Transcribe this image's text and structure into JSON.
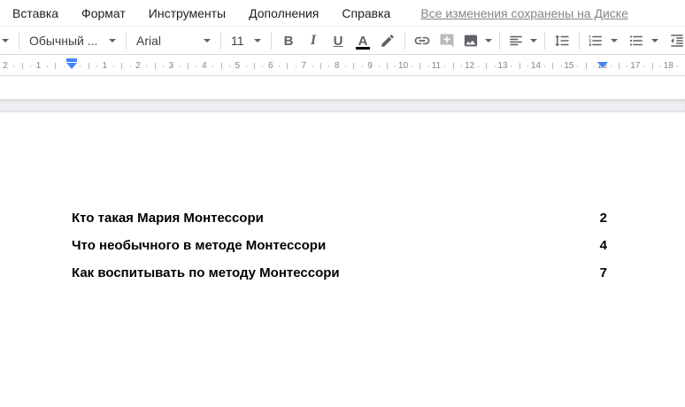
{
  "menu": {
    "items": [
      "Вставка",
      "Формат",
      "Инструменты",
      "Дополнения",
      "Справка"
    ],
    "saved_status": "Все изменения сохранены на Диске"
  },
  "toolbar": {
    "style_dropdown": "Обычный ...",
    "font_dropdown": "Arial",
    "font_size": "11",
    "bold_label": "B",
    "italic_label": "I",
    "underline_label": "U",
    "text_color_label": "A",
    "icons": [
      "highlight-pen",
      "insert-link",
      "add-comment",
      "insert-image",
      "align-left",
      "line-spacing",
      "numbered-list",
      "bulleted-list",
      "indent-decrease"
    ]
  },
  "ruler": {
    "left_labels": [
      "2",
      "1"
    ],
    "right_labels": [
      "1",
      "2",
      "3",
      "4",
      "5",
      "6",
      "7",
      "8",
      "9",
      "10",
      "11",
      "12",
      "13",
      "14",
      "15",
      "16",
      "17",
      "18"
    ]
  },
  "document": {
    "toc": [
      {
        "title": "Кто такая Мария Монтессори",
        "page": "2"
      },
      {
        "title": "Что необычного в методе Монтессори",
        "page": "4"
      },
      {
        "title": "Как воспитывать по методу Монтессори",
        "page": "7"
      }
    ]
  },
  "colors": {
    "accent_blue": "#4285f4",
    "icon_gray": "#5f6368",
    "saved_link_gray": "#80868b",
    "text_color_swatch": "#000000"
  }
}
